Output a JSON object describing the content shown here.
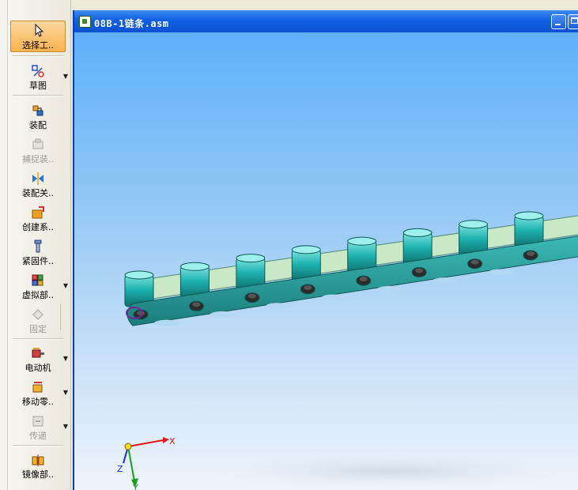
{
  "toolbar": {
    "items": [
      {
        "name": "select-tool",
        "label": "选择工..",
        "state": "active",
        "dropdown": false
      },
      {
        "name": "sketch",
        "label": "草图",
        "state": "normal",
        "dropdown": true
      },
      {
        "name": "assemble",
        "label": "装配",
        "state": "normal",
        "dropdown": false
      },
      {
        "name": "capture-assembly",
        "label": "捕捉装..",
        "state": "disabled",
        "dropdown": false
      },
      {
        "name": "assembly-relation",
        "label": "装配关..",
        "state": "normal",
        "dropdown": false
      },
      {
        "name": "create-system",
        "label": "创建系..",
        "state": "normal",
        "dropdown": false
      },
      {
        "name": "fastener",
        "label": "紧固件..",
        "state": "normal",
        "dropdown": false
      },
      {
        "name": "virtual-part",
        "label": "虚拟部..",
        "state": "normal",
        "dropdown": true
      },
      {
        "name": "fix",
        "label": "固定",
        "state": "disabled",
        "dropdown": false
      },
      {
        "name": "motor",
        "label": "电动机",
        "state": "normal",
        "dropdown": true
      },
      {
        "name": "move-part",
        "label": "移动零..",
        "state": "normal",
        "dropdown": true
      },
      {
        "name": "transmission",
        "label": "传递",
        "state": "disabled",
        "dropdown": true
      },
      {
        "name": "mirror-part",
        "label": "镜像部..",
        "state": "normal",
        "dropdown": false
      }
    ]
  },
  "window": {
    "title": "08B-1链条.asm"
  },
  "triad": {
    "x_label": "X",
    "y_label": "Y",
    "z_label": "Z",
    "x_color": "#e01818",
    "y_color": "#18a018",
    "z_color": "#1830d0"
  },
  "colors": {
    "roller": "#1fb3b0",
    "inner_plate": "#c9e8c5",
    "outer_plate": "#2aa4a2",
    "active_tool": "#f9b24f",
    "titlebar": "#0f5fe0"
  }
}
